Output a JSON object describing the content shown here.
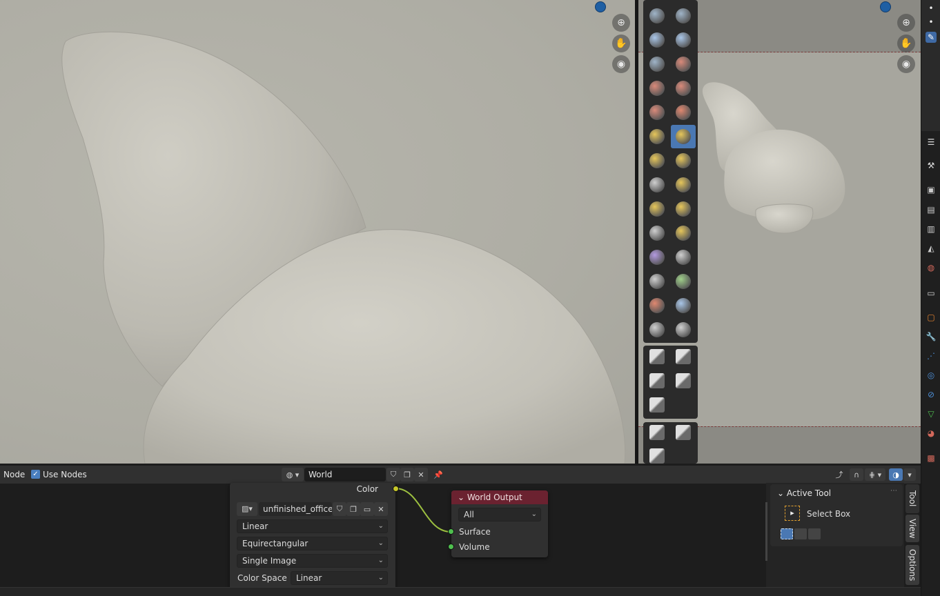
{
  "node_editor": {
    "header": {
      "menu_node": "Node",
      "use_nodes_label": "Use Nodes",
      "use_nodes_checked": true,
      "world_name": "World"
    },
    "image_node": {
      "output_label": "Color",
      "image_name": "unfinished_office...",
      "interpolation": "Linear",
      "projection": "Equirectangular",
      "source": "Single Image",
      "color_space_label": "Color Space",
      "color_space_value": "Linear"
    },
    "output_node": {
      "title": "World Output",
      "target": "All",
      "inputs": [
        "Surface",
        "Volume"
      ]
    },
    "sidebar": {
      "panel_title": "Active Tool",
      "tool_name": "Select Box",
      "tabs": [
        "Tool",
        "View",
        "Options"
      ]
    }
  },
  "colors": {
    "accent": "#4a78b3",
    "output_header": "#6b2230",
    "socket_color": "#c7c729",
    "socket_shader": "#4fbf4f",
    "gizmo_dot": "#1f5fa3"
  },
  "icons": {
    "zoom": "zoom-in-icon",
    "pan": "hand-icon",
    "camera": "camera-icon"
  }
}
